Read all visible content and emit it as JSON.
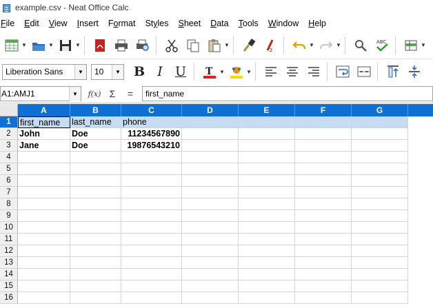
{
  "window": {
    "title": "example.csv - Neat Office Calc"
  },
  "menu": [
    {
      "label": "File",
      "u": "F",
      "rest": "ile"
    },
    {
      "label": "Edit",
      "u": "E",
      "rest": "dit"
    },
    {
      "label": "View",
      "u": "V",
      "rest": "iew"
    },
    {
      "label": "Insert",
      "u": "I",
      "rest": "nsert"
    },
    {
      "label": "Format",
      "pre": "F",
      "u": "o",
      "rest": "rmat"
    },
    {
      "label": "Styles",
      "pre": "St",
      "u": "y",
      "rest": "les"
    },
    {
      "label": "Sheet",
      "u": "S",
      "rest": "heet"
    },
    {
      "label": "Data",
      "u": "D",
      "rest": "ata"
    },
    {
      "label": "Tools",
      "u": "T",
      "rest": "ools"
    },
    {
      "label": "Window",
      "u": "W",
      "rest": "indow"
    },
    {
      "label": "Help",
      "u": "H",
      "rest": "elp"
    }
  ],
  "toolbar_icons": {
    "new": "new-spreadsheet-icon",
    "open": "open-folder-icon",
    "save": "save-icon",
    "pdf": "export-pdf-icon",
    "print": "print-icon",
    "preview": "print-preview-icon",
    "cut": "cut-icon",
    "copy": "copy-icon",
    "paste": "paste-icon",
    "clone": "clone-formatting-icon",
    "clear": "clear-formatting-icon",
    "undo": "undo-icon",
    "redo": "redo-icon",
    "find": "find-replace-icon",
    "spell": "spellcheck-icon",
    "row": "insert-rows-icon"
  },
  "formatting": {
    "font_name": "Liberation Sans",
    "font_size": "10",
    "bold": "B",
    "italic": "I",
    "underline": "U"
  },
  "formula_bar": {
    "name_box": "A1:AMJ1",
    "function_wizard": "f(x)",
    "sum": "Σ",
    "equals": "=",
    "content": "first_name"
  },
  "colors": {
    "header_blue": "#0f70d4",
    "selected_row": "#c6dcf2",
    "font_color_red": "#e02020",
    "highlight_yellow": "#ffd800"
  },
  "grid": {
    "columns": [
      "A",
      "B",
      "C",
      "D",
      "E",
      "F",
      "G"
    ],
    "row_numbers": [
      "1",
      "2",
      "3",
      "4",
      "5",
      "6",
      "7",
      "8",
      "9",
      "10",
      "11",
      "12",
      "13",
      "14",
      "15",
      "16"
    ],
    "cells": [
      [
        "first_name",
        "last_name",
        "phone"
      ],
      [
        "John",
        "Doe",
        "11234567890"
      ],
      [
        "Jane",
        "Doe",
        "19876543210"
      ]
    ]
  }
}
